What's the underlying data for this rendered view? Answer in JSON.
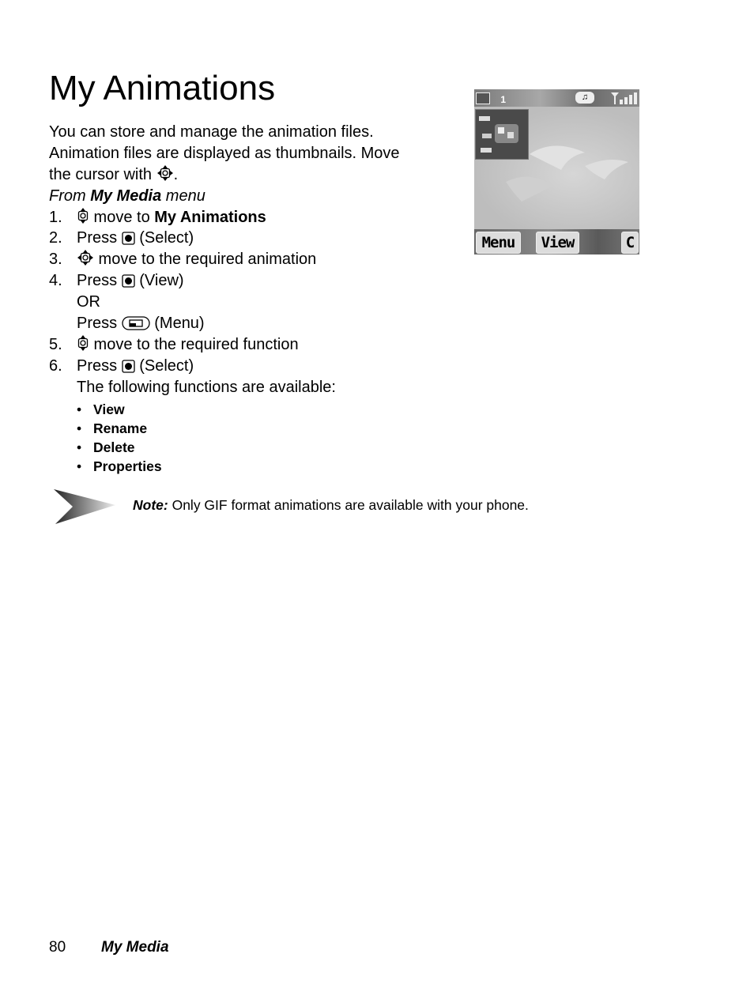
{
  "page": {
    "title": "My Animations",
    "intro_lines": [
      "You can store and manage the animation files.",
      "Animation files are displayed as thumbnails. Move",
      "the cursor with"
    ],
    "intro_end": ".",
    "from_line": {
      "prefix": "From ",
      "menu_name": "My Media",
      "suffix": " menu"
    },
    "steps": [
      {
        "num": "1.",
        "text": " move to ",
        "bold": "My Animations",
        "icon": "up-down-nav-key-icon"
      },
      {
        "num": "2.",
        "text_pre": "Press ",
        "text_post": " (Select)",
        "icon": "center-select-key-icon"
      },
      {
        "num": "3.",
        "text": " move to the required animation",
        "icon": "four-way-nav-key-icon"
      },
      {
        "num": "4.",
        "text_pre": "Press ",
        "text_post": " (View)",
        "icon": "center-select-key-icon",
        "alt_or": "OR",
        "alt_pre": "Press ",
        "alt_post": " (Menu)",
        "alt_icon": "left-soft-key-icon"
      },
      {
        "num": "5.",
        "text": " move to the required function",
        "icon": "up-down-nav-key-icon"
      },
      {
        "num": "6.",
        "text_pre": "Press ",
        "text_post": " (Select)",
        "icon": "center-select-key-icon",
        "after": "The following functions are available:"
      }
    ],
    "functions": [
      "View",
      "Rename",
      "Delete",
      "Properties"
    ],
    "bullet": "•",
    "note": {
      "label": "Note:",
      "text": " Only GIF format animations are available with your phone."
    },
    "footer": {
      "page_number": "80",
      "section": "My Media"
    }
  },
  "phone_screen": {
    "status_icons": [
      "battery-icon",
      "line-1-icon",
      "vibrate-ring-icon",
      "signal-strength-icon"
    ],
    "line_indicator": "1",
    "softkeys": {
      "left": "Menu",
      "center": "View",
      "right": "C"
    }
  }
}
